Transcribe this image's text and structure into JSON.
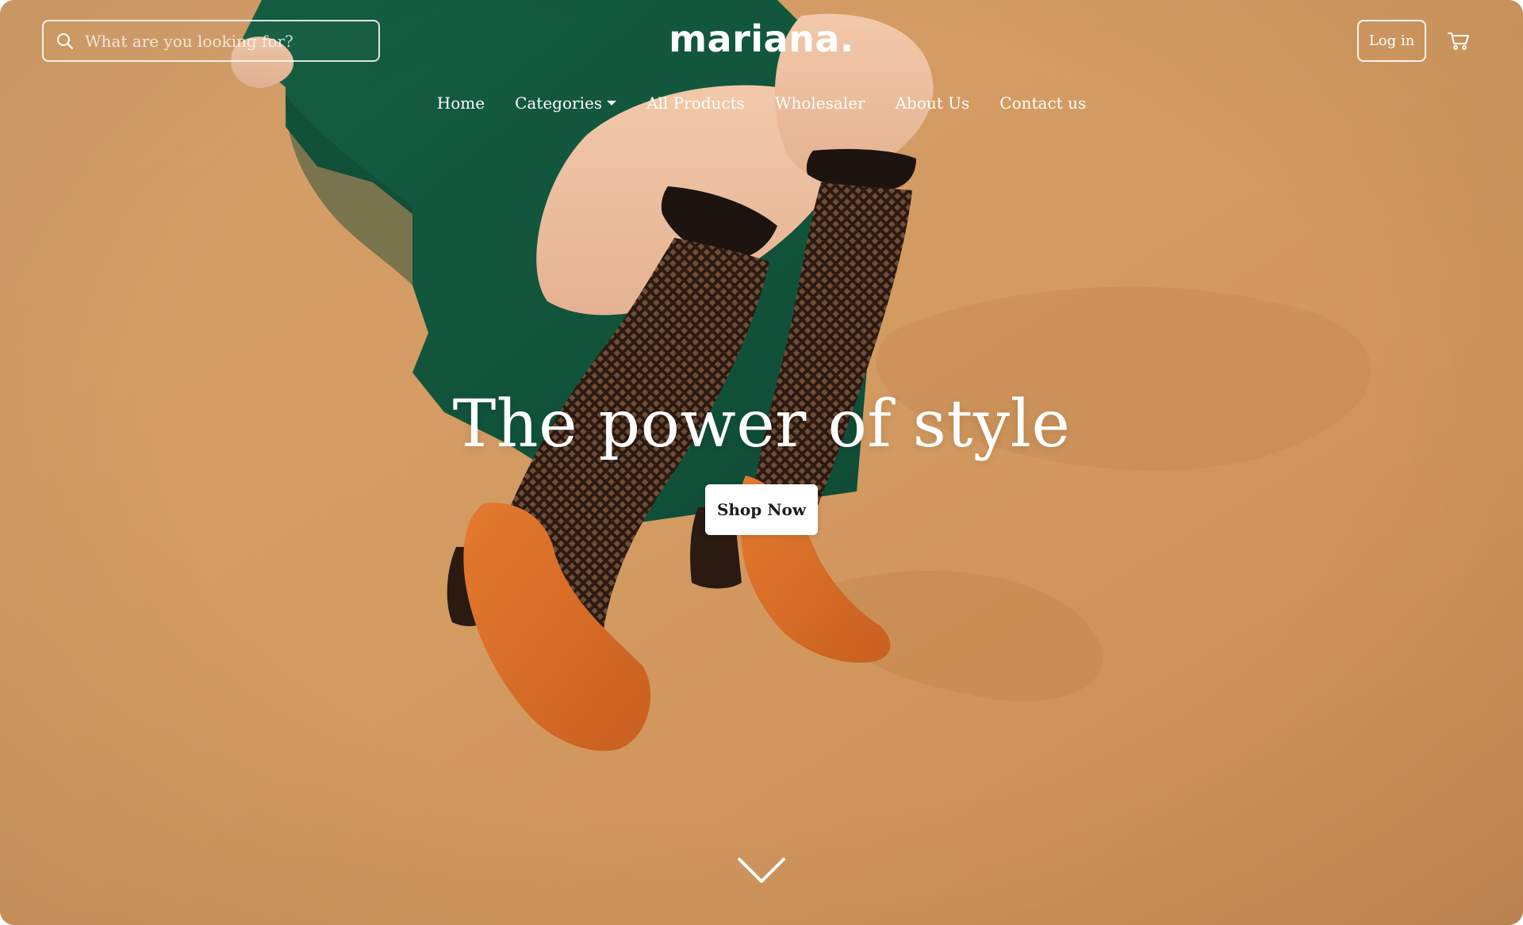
{
  "header": {
    "search": {
      "placeholder": "What are you looking for?",
      "icon": "search-icon"
    },
    "logo": "mariana.",
    "login_label": "Log in",
    "cart_icon": "cart-icon"
  },
  "nav": {
    "items": [
      {
        "label": "Home"
      },
      {
        "label": "Categories",
        "has_dropdown": true
      },
      {
        "label": "All Products"
      },
      {
        "label": "Wholesaler"
      },
      {
        "label": "About Us"
      },
      {
        "label": "Contact us"
      }
    ]
  },
  "hero": {
    "headline": "The power of style",
    "cta_label": "Shop Now",
    "scroll_icon": "chevron-down-icon"
  },
  "colors": {
    "background": "#d39a62",
    "text": "#ffffff",
    "cta_background": "#ffffff",
    "cta_text": "#1c1c1c",
    "dress": "#13593f",
    "shoe": "#d96e26"
  }
}
